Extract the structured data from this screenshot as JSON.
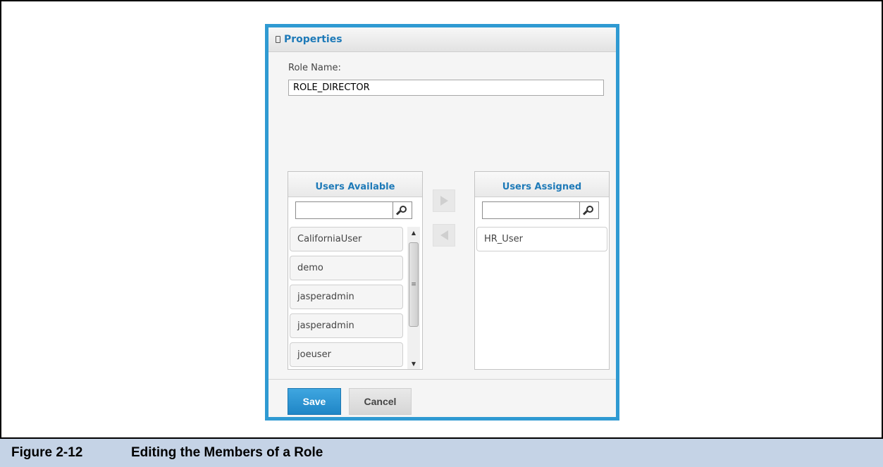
{
  "panel": {
    "title": "Properties",
    "role_name_label": "Role Name:",
    "role_name_value": "ROLE_DIRECTOR"
  },
  "users_available": {
    "title": "Users Available",
    "search_value": "",
    "items": [
      "CaliforniaUser",
      "demo",
      "jasperadmin",
      "jasperadmin",
      "joeuser"
    ]
  },
  "users_assigned": {
    "title": "Users Assigned",
    "search_value": "",
    "items": [
      "HR_User"
    ]
  },
  "buttons": {
    "save": "Save",
    "cancel": "Cancel"
  },
  "caption": {
    "number": "Figure 2-12",
    "text": "Editing the Members of a Role"
  },
  "colors": {
    "panel_border": "#2f9ad2",
    "accent_text": "#1e7ab8",
    "caption_bg": "#c5d3e6"
  },
  "icons": {
    "header": "collapse-icon",
    "search": "search-icon",
    "add": "arrow-right-icon",
    "remove": "arrow-left-icon"
  }
}
